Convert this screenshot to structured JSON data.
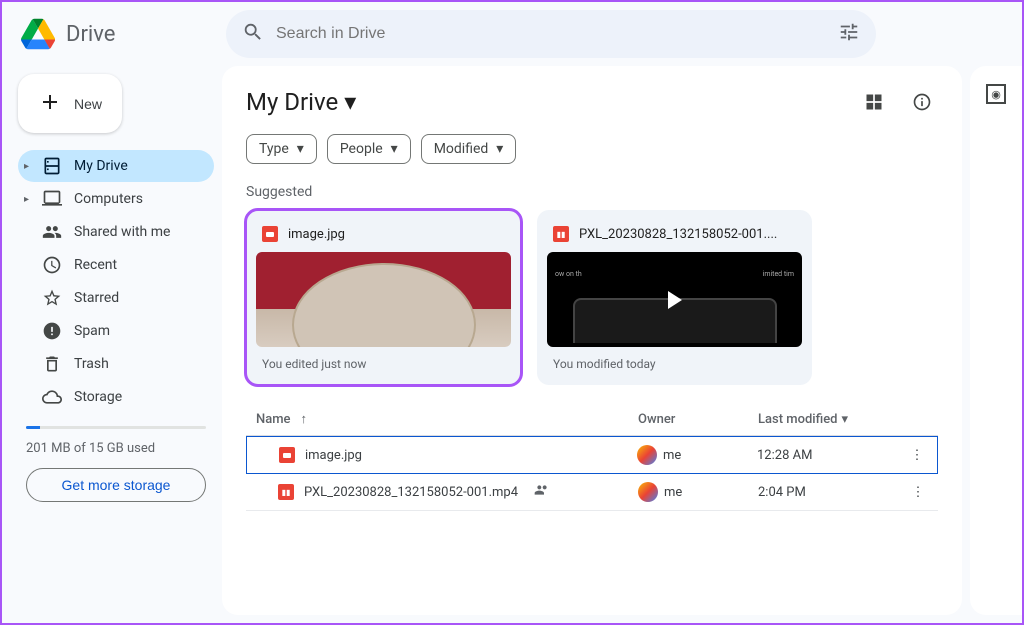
{
  "app_name": "Drive",
  "search": {
    "placeholder": "Search in Drive"
  },
  "new_button": "New",
  "sidebar": {
    "items": [
      {
        "label": "My Drive",
        "active": true,
        "expandable": true
      },
      {
        "label": "Computers",
        "active": false,
        "expandable": true
      },
      {
        "label": "Shared with me",
        "active": false
      },
      {
        "label": "Recent",
        "active": false
      },
      {
        "label": "Starred",
        "active": false
      },
      {
        "label": "Spam",
        "active": false
      },
      {
        "label": "Trash",
        "active": false
      },
      {
        "label": "Storage",
        "active": false
      }
    ],
    "storage_text": "201 MB of 15 GB used",
    "get_more": "Get more storage"
  },
  "breadcrumb": "My Drive",
  "filters": [
    "Type",
    "People",
    "Modified"
  ],
  "suggested_label": "Suggested",
  "suggested": [
    {
      "name": "image.jpg",
      "subtitle": "You edited just now",
      "kind": "image",
      "highlighted": true
    },
    {
      "name": "PXL_20230828_132158052-001....",
      "subtitle": "You modified today",
      "kind": "video",
      "highlighted": false
    }
  ],
  "columns": {
    "name": "Name",
    "owner": "Owner",
    "modified": "Last modified"
  },
  "files": [
    {
      "name": "image.jpg",
      "owner": "me",
      "modified": "12:28 AM",
      "kind": "image",
      "shared": false,
      "selected": true
    },
    {
      "name": "PXL_20230828_132158052-001.mp4",
      "owner": "me",
      "modified": "2:04 PM",
      "kind": "video",
      "shared": true,
      "selected": false
    }
  ]
}
